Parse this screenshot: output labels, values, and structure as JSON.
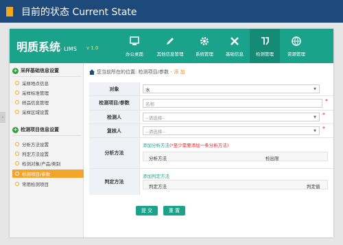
{
  "slide": {
    "title": "目前的状态 Current State"
  },
  "app": {
    "logo": "明质系统",
    "logo_sub": "· LIMS",
    "version": "v 1.0",
    "nav": [
      {
        "label": "办公桌面",
        "icon": "desk-icon"
      },
      {
        "label": "其他信息管理",
        "icon": "edit-icon"
      },
      {
        "label": "系统管理",
        "icon": "gear-icon"
      },
      {
        "label": "基础信息",
        "icon": "tools-icon"
      },
      {
        "label": "检测管理",
        "icon": "test-icon",
        "active": true
      },
      {
        "label": "资源管理",
        "icon": "globe-icon"
      }
    ]
  },
  "sidebar": {
    "section1": "采样基础信息设置",
    "items1": [
      "采样地点信息",
      "采样标准管理",
      "样品信息管理",
      "采样区域设置"
    ],
    "section2": "检测项目信息设置",
    "items2": [
      "分析方法设置",
      "判定方法设置",
      "检测对象/产品/类别",
      "检测项目/参数",
      "常用检测项目"
    ],
    "active": "检测项目/参数"
  },
  "breadcrumb": {
    "prefix": "您当前所在的位置:",
    "path": "检测项目/参数",
    "sep": "·",
    "current": "添 加"
  },
  "form": {
    "object_label": "对象",
    "object_value": "水",
    "item_label": "检测项目/参数",
    "item_placeholder": "名称",
    "tester_label": "检测人",
    "tester_value": "--请选择--",
    "reviewer_label": "复核人",
    "reviewer_value": "--请选择--",
    "method_label": "分析方法",
    "method_link": "添加分析方法",
    "method_warn": "(*至少需要添加一条分析方法)",
    "method_cols": [
      "分析方法",
      "检出限"
    ],
    "judge_label": "判定方法",
    "judge_link": "添加判定方法",
    "judge_cols": [
      "判定方法",
      "判定值"
    ],
    "required": "*"
  },
  "buttons": {
    "submit": "提 交",
    "reset": "重 置"
  },
  "colors": {
    "header": "#1d4a7a",
    "accent": "#f4a81d",
    "brand": "#1ba28a",
    "active": "#f3a42b"
  }
}
